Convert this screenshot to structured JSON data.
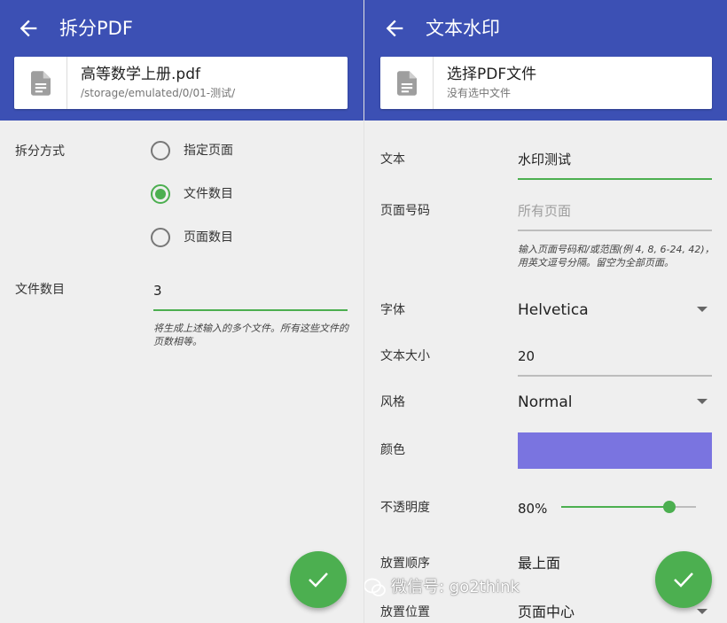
{
  "colors": {
    "app_bar": "#3c50b4",
    "accent": "#4caf50",
    "watermark_color": "#7a74e0"
  },
  "left": {
    "title": "拆分PDF",
    "file": {
      "name": "高等数学上册.pdf",
      "path": "/storage/emulated/0/01-测试/"
    },
    "split_mode": {
      "label": "拆分方式",
      "options": [
        "指定页面",
        "文件数目",
        "页面数目"
      ],
      "selected": "文件数目"
    },
    "file_count": {
      "label": "文件数目",
      "value": "3",
      "hint": "将生成上述输入的多个文件。所有这些文件的页数相等。"
    }
  },
  "right": {
    "title": "文本水印",
    "file": {
      "name": "选择PDF文件",
      "path": "没有选中文件"
    },
    "text": {
      "label": "文本",
      "value": "水印测试"
    },
    "page_numbers": {
      "label": "页面号码",
      "placeholder": "所有页面",
      "hint": "输入页面号码和/或范围(例 4, 8, 6-24, 42)，用英文逗号分隔。留空为全部页面。"
    },
    "font": {
      "label": "字体",
      "value": "Helvetica"
    },
    "text_size": {
      "label": "文本大小",
      "value": "20"
    },
    "style": {
      "label": "风格",
      "value": "Normal"
    },
    "color": {
      "label": "颜色"
    },
    "opacity": {
      "label": "不透明度",
      "value_text": "80%",
      "value": 0.8
    },
    "order": {
      "label": "放置顺序",
      "value": "最上面"
    },
    "position": {
      "label": "放置位置",
      "value": "页面中心"
    }
  },
  "overlay": {
    "watermark_text": "微信号: go2think"
  }
}
